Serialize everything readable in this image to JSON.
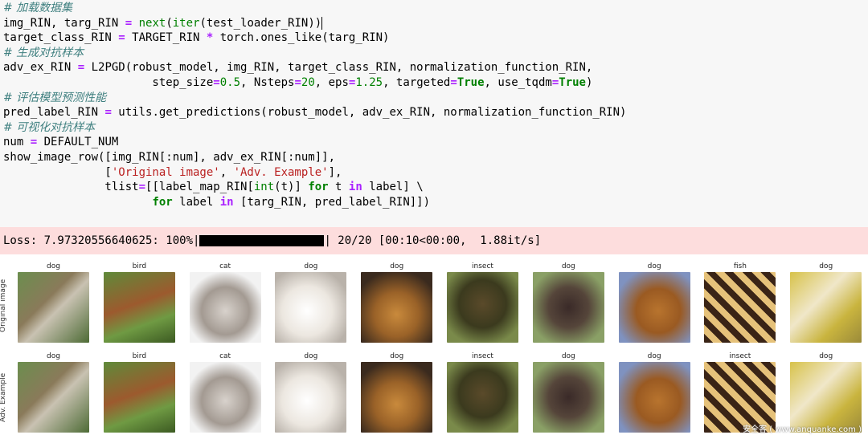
{
  "code": {
    "comment1": "# 加载数据集",
    "comment2": "# 生成对抗样本",
    "comment3": "# 评估模型预测性能",
    "comment4": "# 可视化对抗样本"
  },
  "output": {
    "prefix": "Loss: 7.97320556640625: 100%|",
    "suffix": "| 20/20 [00:10<00:00,  1.88it/s]",
    "progress_fraction": 1.0
  },
  "grid": {
    "row_labels": [
      "Original image",
      "Adv. Example"
    ],
    "original_titles": [
      "dog",
      "bird",
      "cat",
      "dog",
      "dog",
      "insect",
      "dog",
      "dog",
      "fish",
      "dog"
    ],
    "adversarial_titles": [
      "dog",
      "bird",
      "cat",
      "dog",
      "dog",
      "insect",
      "dog",
      "dog",
      "insect",
      "dog"
    ]
  },
  "watermark": "安全客 ( www.anquanke.com )"
}
